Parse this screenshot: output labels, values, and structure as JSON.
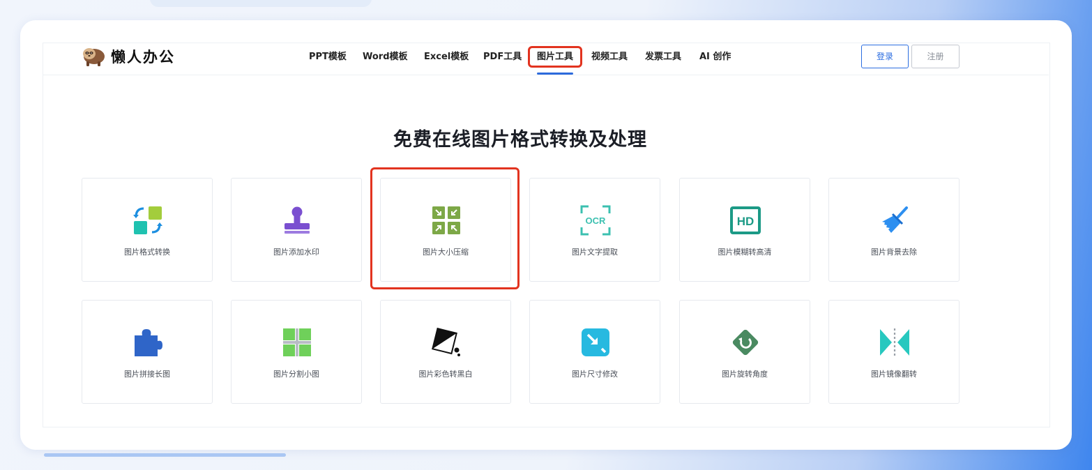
{
  "brand": {
    "name": "懒人办公",
    "logo_icon": "sloth-icon"
  },
  "nav": {
    "items": [
      {
        "label": "PPT模板"
      },
      {
        "label": "Word模板"
      },
      {
        "label": "Excel模板"
      },
      {
        "label": "PDF工具"
      },
      {
        "label": "图片工具",
        "active": true
      },
      {
        "label": "视频工具"
      },
      {
        "label": "发票工具"
      },
      {
        "label": "AI 创作"
      }
    ]
  },
  "auth": {
    "login_label": "登录",
    "register_label": "注册"
  },
  "main": {
    "title": "免费在线图片格式转换及处理",
    "tools": [
      {
        "label": "图片格式转换",
        "icon": "format-convert-icon"
      },
      {
        "label": "图片添加水印",
        "icon": "stamp-icon"
      },
      {
        "label": "图片大小压缩",
        "icon": "compress-icon"
      },
      {
        "label": "图片文字提取",
        "icon": "ocr-icon",
        "icon_text": "OCR"
      },
      {
        "label": "图片模糊转高清",
        "icon": "hd-icon",
        "icon_text": "HD"
      },
      {
        "label": "图片背景去除",
        "icon": "broom-icon"
      },
      {
        "label": "图片拼接长图",
        "icon": "puzzle-icon"
      },
      {
        "label": "图片分割小图",
        "icon": "grid-split-icon"
      },
      {
        "label": "图片彩色转黑白",
        "icon": "color-to-bw-icon"
      },
      {
        "label": "图片尺寸修改",
        "icon": "resize-icon"
      },
      {
        "label": "图片旋转角度",
        "icon": "rotate-icon"
      },
      {
        "label": "图片镜像翻转",
        "icon": "mirror-flip-icon"
      }
    ]
  },
  "colors": {
    "accent": "#2b6de0",
    "highlight": "#e2331f",
    "ocr": "#3cc0b0",
    "hd": "#1c9a86",
    "compress": "#7da847",
    "stamp": "#7a4fd0"
  }
}
